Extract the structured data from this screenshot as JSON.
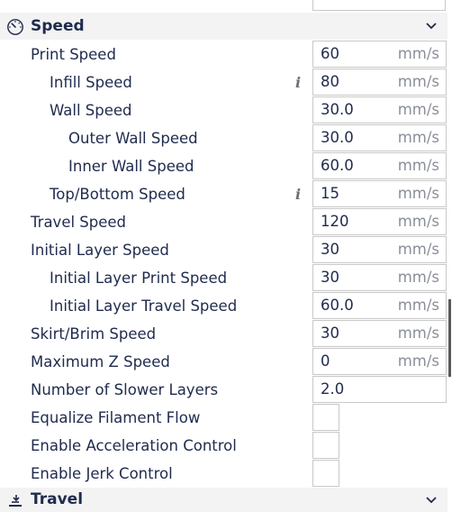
{
  "speed_section": {
    "title": "Speed",
    "icon": "speedometer-icon"
  },
  "travel_section": {
    "title": "Travel",
    "icon": "travel-icon"
  },
  "rows": [
    {
      "label": "Print Speed",
      "value": "60",
      "unit": "mm/s"
    },
    {
      "label": "Infill Speed",
      "value": "80",
      "unit": "mm/s",
      "info": true
    },
    {
      "label": "Wall Speed",
      "value": "30.0",
      "unit": "mm/s"
    },
    {
      "label": "Outer Wall Speed",
      "value": "30.0",
      "unit": "mm/s"
    },
    {
      "label": "Inner Wall Speed",
      "value": "60.0",
      "unit": "mm/s"
    },
    {
      "label": "Top/Bottom Speed",
      "value": "15",
      "unit": "mm/s",
      "info": true
    },
    {
      "label": "Travel Speed",
      "value": "120",
      "unit": "mm/s"
    },
    {
      "label": "Initial Layer Speed",
      "value": "30",
      "unit": "mm/s"
    },
    {
      "label": "Initial Layer Print Speed",
      "value": "30",
      "unit": "mm/s"
    },
    {
      "label": "Initial Layer Travel Speed",
      "value": "60.0",
      "unit": "mm/s"
    },
    {
      "label": "Skirt/Brim Speed",
      "value": "30",
      "unit": "mm/s"
    },
    {
      "label": "Maximum Z Speed",
      "value": "0",
      "unit": "mm/s"
    },
    {
      "label": "Number of Slower Layers",
      "value": "2.0",
      "unit": ""
    },
    {
      "label": "Equalize Filament Flow",
      "checked": false
    },
    {
      "label": "Enable Acceleration Control",
      "checked": false
    },
    {
      "label": "Enable Jerk Control",
      "checked": false
    }
  ]
}
